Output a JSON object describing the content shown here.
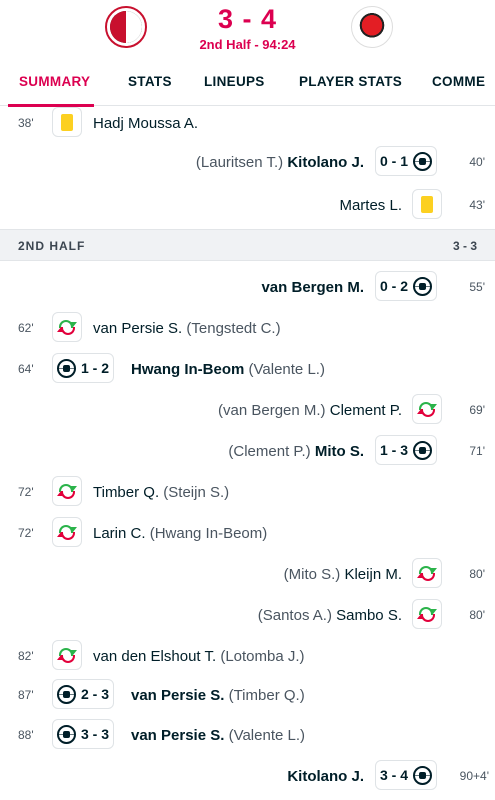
{
  "match": {
    "score": "3 - 4",
    "status": "2nd Half - 94:24",
    "home_logo": "feyenoord-crest-icon",
    "away_logo": "sparta-crest-icon"
  },
  "tabs": [
    {
      "label": "SUMMARY",
      "active": true
    },
    {
      "label": "STATS"
    },
    {
      "label": "LINEUPS"
    },
    {
      "label": "PLAYER STATS"
    },
    {
      "label": "COMME"
    }
  ],
  "section": {
    "title": "2ND HALF",
    "score": "3 - 3"
  },
  "events": [
    {
      "minute": "38'",
      "type": "yellow-card",
      "side": "home",
      "player": "Hadj Moussa A."
    },
    {
      "minute": "40'",
      "type": "goal",
      "side": "away",
      "player": "Kitolano J.",
      "assist": "(Lauritsen T.)",
      "score": "0 - 1"
    },
    {
      "minute": "43'",
      "type": "yellow-card",
      "side": "away",
      "player": "Martes L."
    },
    {
      "minute": "55'",
      "type": "goal",
      "side": "away",
      "player": "van Bergen M.",
      "score": "0 - 2"
    },
    {
      "minute": "62'",
      "type": "substitution",
      "side": "home",
      "player": "van Persie S.",
      "assist": "(Tengstedt C.)"
    },
    {
      "minute": "64'",
      "type": "goal",
      "side": "home",
      "player": "Hwang In-Beom",
      "assist": "(Valente L.)",
      "score": "1 - 2"
    },
    {
      "minute": "69'",
      "type": "substitution",
      "side": "away",
      "player": "Clement P.",
      "assist": "(van Bergen M.)"
    },
    {
      "minute": "71'",
      "type": "goal",
      "side": "away",
      "player": "Mito S.",
      "assist": "(Clement P.)",
      "score": "1 - 3"
    },
    {
      "minute": "72'",
      "type": "substitution",
      "side": "home",
      "player": "Timber Q.",
      "assist": "(Steijn S.)"
    },
    {
      "minute": "72'",
      "type": "substitution",
      "side": "home",
      "player": "Larin C.",
      "assist": "(Hwang In-Beom)"
    },
    {
      "minute": "80'",
      "type": "substitution",
      "side": "away",
      "player": "Kleijn M.",
      "assist": "(Mito S.)"
    },
    {
      "minute": "80'",
      "type": "substitution",
      "side": "away",
      "player": "Sambo S.",
      "assist": "(Santos A.)"
    },
    {
      "minute": "82'",
      "type": "substitution",
      "side": "home",
      "player": "van den Elshout T.",
      "assist": "(Lotomba J.)"
    },
    {
      "minute": "87'",
      "type": "goal",
      "side": "home",
      "player": "van Persie S.",
      "assist": "(Timber Q.)",
      "score": "2 - 3"
    },
    {
      "minute": "88'",
      "type": "goal",
      "side": "home",
      "player": "van Persie S.",
      "assist": "(Valente L.)",
      "score": "3 - 3"
    },
    {
      "minute": "90+4'",
      "type": "goal",
      "side": "away",
      "player": "Kitolano J.",
      "score": "3 - 4"
    }
  ]
}
